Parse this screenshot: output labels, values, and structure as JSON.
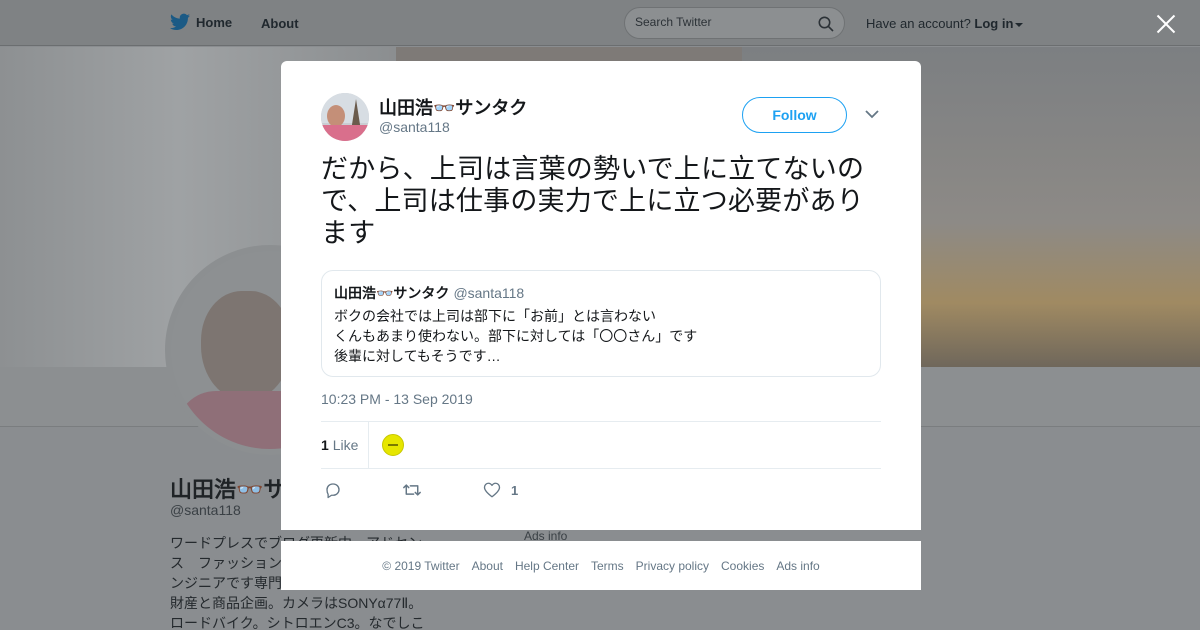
{
  "topnav": {
    "home_label": "Home",
    "about_label": "About",
    "search_placeholder": "Search Twitter",
    "account_prompt": "Have an account?",
    "login_label": "Log in"
  },
  "profile": {
    "name": "山田浩👓サ",
    "handle": "@santa118",
    "bio_lines": [
      "ワードプレスでブログ更新中。アドセン",
      "ス　ファッション",
      "ンジニアです専門",
      "財産と商品企画。カメラはSONYα77Ⅱ。",
      "ロードバイク。シトロエンC3。なでしこ"
    ],
    "ads_info": "Ads info"
  },
  "tweet": {
    "author_name": "山田浩👓サンタク",
    "author_handle": "@santa118",
    "follow_label": "Follow",
    "text": "だから、上司は言葉の勢いで上に立てないので、上司は仕事の実力で上に立つ必要があります",
    "quote": {
      "author_name": "山田浩👓サンタク",
      "author_handle": "@santa118",
      "text": "ボクの会社では上司は部下に「お前」とは言わない\nくんもあまり使わない。部下に対しては「〇〇さん」です\n後輩に対してもそうです…"
    },
    "timestamp": "10:23 PM - 13 Sep 2019",
    "likes_count": "1",
    "likes_label": "Like",
    "action_like_count": "1"
  },
  "footer": {
    "copyright": "© 2019 Twitter",
    "links": [
      "About",
      "Help Center",
      "Terms",
      "Privacy policy",
      "Cookies",
      "Ads info"
    ]
  },
  "colors": {
    "twitter_blue": "#1da1f2",
    "secondary_text": "#657786",
    "primary_text": "#14171a",
    "overlay_background": "#8a8d90"
  },
  "icons": [
    "twitter-bird-icon",
    "search-icon",
    "close-icon",
    "chevron-down-icon",
    "reply-icon",
    "retweet-icon",
    "heart-icon"
  ]
}
